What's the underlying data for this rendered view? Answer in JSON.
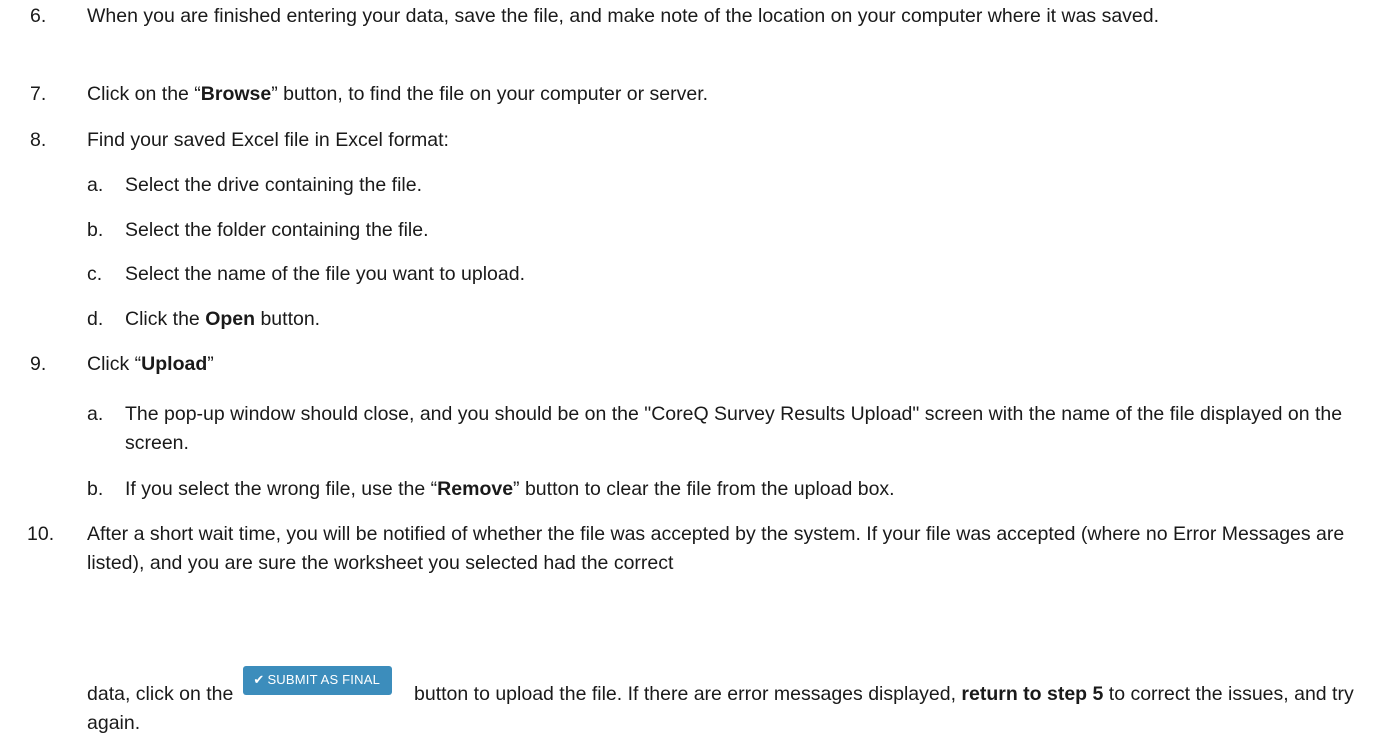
{
  "steps": {
    "s6": {
      "num": "6.",
      "text": "When you are finished entering your data, save the file, and make note of the location on your computer where it was saved."
    },
    "s7": {
      "num": "7.",
      "pre": "Click on the “",
      "bold": "Browse",
      "post": "” button, to find the file on your computer or server."
    },
    "s8": {
      "num": "8.",
      "text": "Find your saved Excel file in Excel format:",
      "subs": {
        "a": {
          "letter": "a.",
          "text": "Select the drive containing the file."
        },
        "b": {
          "letter": "b.",
          "text": "Select the folder containing the file."
        },
        "c": {
          "letter": "c.",
          "text": "Select the name of the file you want to upload."
        },
        "d": {
          "letter": "d.",
          "pre": "Click the ",
          "bold": "Open",
          "post": " button."
        }
      }
    },
    "s9": {
      "num": "9.",
      "pre": "Click “",
      "bold": "Upload",
      "post": "”",
      "subs": {
        "a": {
          "letter": "a.",
          "text": "The pop-up window should close, and you should be on the \"CoreQ Survey Results Upload\" screen with the name of the file displayed on the screen."
        },
        "b": {
          "letter": "b.",
          "pre": "If you select the wrong file, use the “",
          "bold": "Remove",
          "post": "” button to clear the file from the upload box."
        }
      }
    },
    "s10": {
      "num": "10.",
      "text1": "After a short wait time, you will be notified of whether the file was accepted by the system. If your file was accepted (where no Error Messages are listed), and you are sure the worksheet you selected had the correct",
      "text2_pre": "data, click on the",
      "button_label": "SUBMIT AS FINAL",
      "text2_post": "button to upload the file. If there are error messages displayed,",
      "bold": "return to step 5",
      "text2_end": "to correct the issues, and try again."
    }
  },
  "icons": {
    "submit": "check-icon"
  },
  "colors": {
    "button_bg": "#3c8dbc",
    "button_text": "#ffffff"
  }
}
